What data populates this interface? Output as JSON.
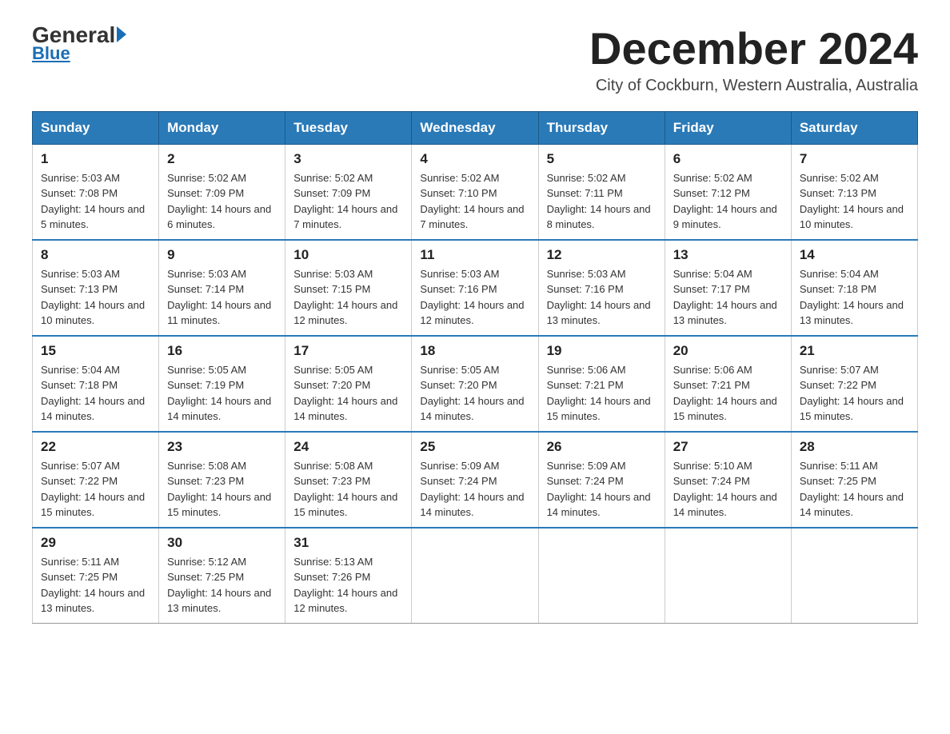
{
  "logo": {
    "general": "General",
    "triangle": "",
    "blue": "Blue"
  },
  "header": {
    "month_title": "December 2024",
    "subtitle": "City of Cockburn, Western Australia, Australia"
  },
  "days_of_week": [
    "Sunday",
    "Monday",
    "Tuesday",
    "Wednesday",
    "Thursday",
    "Friday",
    "Saturday"
  ],
  "weeks": [
    [
      {
        "day": "1",
        "sunrise": "Sunrise: 5:03 AM",
        "sunset": "Sunset: 7:08 PM",
        "daylight": "Daylight: 14 hours and 5 minutes."
      },
      {
        "day": "2",
        "sunrise": "Sunrise: 5:02 AM",
        "sunset": "Sunset: 7:09 PM",
        "daylight": "Daylight: 14 hours and 6 minutes."
      },
      {
        "day": "3",
        "sunrise": "Sunrise: 5:02 AM",
        "sunset": "Sunset: 7:09 PM",
        "daylight": "Daylight: 14 hours and 7 minutes."
      },
      {
        "day": "4",
        "sunrise": "Sunrise: 5:02 AM",
        "sunset": "Sunset: 7:10 PM",
        "daylight": "Daylight: 14 hours and 7 minutes."
      },
      {
        "day": "5",
        "sunrise": "Sunrise: 5:02 AM",
        "sunset": "Sunset: 7:11 PM",
        "daylight": "Daylight: 14 hours and 8 minutes."
      },
      {
        "day": "6",
        "sunrise": "Sunrise: 5:02 AM",
        "sunset": "Sunset: 7:12 PM",
        "daylight": "Daylight: 14 hours and 9 minutes."
      },
      {
        "day": "7",
        "sunrise": "Sunrise: 5:02 AM",
        "sunset": "Sunset: 7:13 PM",
        "daylight": "Daylight: 14 hours and 10 minutes."
      }
    ],
    [
      {
        "day": "8",
        "sunrise": "Sunrise: 5:03 AM",
        "sunset": "Sunset: 7:13 PM",
        "daylight": "Daylight: 14 hours and 10 minutes."
      },
      {
        "day": "9",
        "sunrise": "Sunrise: 5:03 AM",
        "sunset": "Sunset: 7:14 PM",
        "daylight": "Daylight: 14 hours and 11 minutes."
      },
      {
        "day": "10",
        "sunrise": "Sunrise: 5:03 AM",
        "sunset": "Sunset: 7:15 PM",
        "daylight": "Daylight: 14 hours and 12 minutes."
      },
      {
        "day": "11",
        "sunrise": "Sunrise: 5:03 AM",
        "sunset": "Sunset: 7:16 PM",
        "daylight": "Daylight: 14 hours and 12 minutes."
      },
      {
        "day": "12",
        "sunrise": "Sunrise: 5:03 AM",
        "sunset": "Sunset: 7:16 PM",
        "daylight": "Daylight: 14 hours and 13 minutes."
      },
      {
        "day": "13",
        "sunrise": "Sunrise: 5:04 AM",
        "sunset": "Sunset: 7:17 PM",
        "daylight": "Daylight: 14 hours and 13 minutes."
      },
      {
        "day": "14",
        "sunrise": "Sunrise: 5:04 AM",
        "sunset": "Sunset: 7:18 PM",
        "daylight": "Daylight: 14 hours and 13 minutes."
      }
    ],
    [
      {
        "day": "15",
        "sunrise": "Sunrise: 5:04 AM",
        "sunset": "Sunset: 7:18 PM",
        "daylight": "Daylight: 14 hours and 14 minutes."
      },
      {
        "day": "16",
        "sunrise": "Sunrise: 5:05 AM",
        "sunset": "Sunset: 7:19 PM",
        "daylight": "Daylight: 14 hours and 14 minutes."
      },
      {
        "day": "17",
        "sunrise": "Sunrise: 5:05 AM",
        "sunset": "Sunset: 7:20 PM",
        "daylight": "Daylight: 14 hours and 14 minutes."
      },
      {
        "day": "18",
        "sunrise": "Sunrise: 5:05 AM",
        "sunset": "Sunset: 7:20 PM",
        "daylight": "Daylight: 14 hours and 14 minutes."
      },
      {
        "day": "19",
        "sunrise": "Sunrise: 5:06 AM",
        "sunset": "Sunset: 7:21 PM",
        "daylight": "Daylight: 14 hours and 15 minutes."
      },
      {
        "day": "20",
        "sunrise": "Sunrise: 5:06 AM",
        "sunset": "Sunset: 7:21 PM",
        "daylight": "Daylight: 14 hours and 15 minutes."
      },
      {
        "day": "21",
        "sunrise": "Sunrise: 5:07 AM",
        "sunset": "Sunset: 7:22 PM",
        "daylight": "Daylight: 14 hours and 15 minutes."
      }
    ],
    [
      {
        "day": "22",
        "sunrise": "Sunrise: 5:07 AM",
        "sunset": "Sunset: 7:22 PM",
        "daylight": "Daylight: 14 hours and 15 minutes."
      },
      {
        "day": "23",
        "sunrise": "Sunrise: 5:08 AM",
        "sunset": "Sunset: 7:23 PM",
        "daylight": "Daylight: 14 hours and 15 minutes."
      },
      {
        "day": "24",
        "sunrise": "Sunrise: 5:08 AM",
        "sunset": "Sunset: 7:23 PM",
        "daylight": "Daylight: 14 hours and 15 minutes."
      },
      {
        "day": "25",
        "sunrise": "Sunrise: 5:09 AM",
        "sunset": "Sunset: 7:24 PM",
        "daylight": "Daylight: 14 hours and 14 minutes."
      },
      {
        "day": "26",
        "sunrise": "Sunrise: 5:09 AM",
        "sunset": "Sunset: 7:24 PM",
        "daylight": "Daylight: 14 hours and 14 minutes."
      },
      {
        "day": "27",
        "sunrise": "Sunrise: 5:10 AM",
        "sunset": "Sunset: 7:24 PM",
        "daylight": "Daylight: 14 hours and 14 minutes."
      },
      {
        "day": "28",
        "sunrise": "Sunrise: 5:11 AM",
        "sunset": "Sunset: 7:25 PM",
        "daylight": "Daylight: 14 hours and 14 minutes."
      }
    ],
    [
      {
        "day": "29",
        "sunrise": "Sunrise: 5:11 AM",
        "sunset": "Sunset: 7:25 PM",
        "daylight": "Daylight: 14 hours and 13 minutes."
      },
      {
        "day": "30",
        "sunrise": "Sunrise: 5:12 AM",
        "sunset": "Sunset: 7:25 PM",
        "daylight": "Daylight: 14 hours and 13 minutes."
      },
      {
        "day": "31",
        "sunrise": "Sunrise: 5:13 AM",
        "sunset": "Sunset: 7:26 PM",
        "daylight": "Daylight: 14 hours and 12 minutes."
      },
      null,
      null,
      null,
      null
    ]
  ]
}
